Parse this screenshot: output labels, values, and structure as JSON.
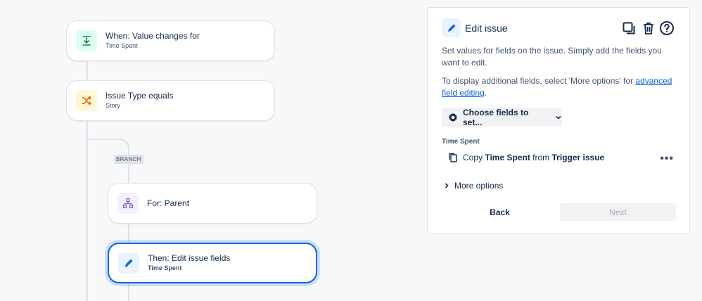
{
  "canvas": {
    "trigger": {
      "title": "When: Value changes for",
      "subtitle": "Time Spent"
    },
    "condition": {
      "title": "Issue Type equals",
      "subtitle": "Story"
    },
    "branch_tag": "BRANCH",
    "branch": {
      "title": "For: Parent"
    },
    "action": {
      "title": "Then: Edit issue fields",
      "subtitle": "Time Spent"
    }
  },
  "panel": {
    "title": "Edit issue",
    "description": "Set values for fields on the issue. Simply add the fields you want to edit.",
    "additional_prefix": "To display additional fields, select 'More options' for ",
    "additional_link": "advanced field editing",
    "additional_suffix": ".",
    "choose_fields_label": "Choose fields to set...",
    "field": {
      "label": "Time Spent",
      "copy_word": "Copy",
      "field_name": "Time Spent",
      "from_word": "from",
      "source": "Trigger issue"
    },
    "more_options_label": "More options",
    "back_label": "Back",
    "next_label": "Next"
  },
  "colors": {
    "accent": "#0c66e4",
    "trigger_icon_bg": "#dcfff1",
    "condition_icon_bg": "#fff7d6",
    "branch_icon_bg": "#f3f0ff",
    "action_icon_bg": "#e9f2ff"
  }
}
